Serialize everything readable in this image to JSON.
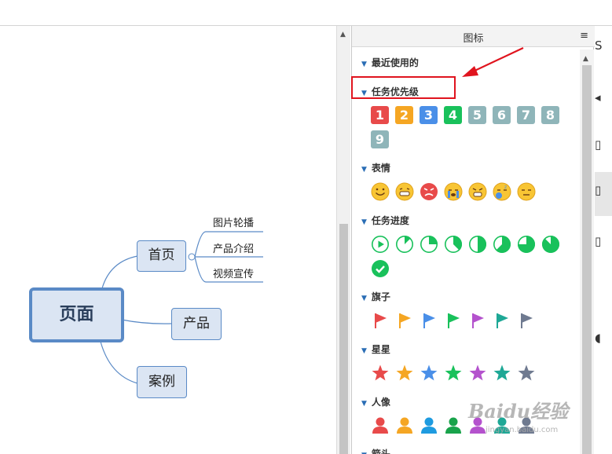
{
  "mindmap": {
    "root": "页面",
    "branches": [
      "首页",
      "产品",
      "案例"
    ],
    "leaves": [
      "图片轮播",
      "产品介绍",
      "视频宣传"
    ]
  },
  "panel": {
    "title": "图标",
    "menu_icon": "≡",
    "sections": [
      {
        "title": "最近使用的"
      },
      {
        "title": "任务优先级",
        "items": [
          "1",
          "2",
          "3",
          "4",
          "5",
          "6",
          "7",
          "8",
          "9"
        ],
        "colors": [
          "#e84a4a",
          "#f5a623",
          "#4a8fe8",
          "#19c15b",
          "#8fb5b9",
          "#8fb5b9",
          "#8fb5b9",
          "#8fb5b9",
          "#8fb5b9"
        ]
      },
      {
        "title": "表情",
        "items": [
          "smile-face-icon",
          "grin-face-icon",
          "angry-face-icon",
          "crying-face-icon",
          "scream-face-icon",
          "sleepy-face-icon",
          "neutral-face-icon"
        ]
      },
      {
        "title": "任务进度",
        "items": [
          "progress-start-icon",
          "progress-12-icon",
          "progress-25-icon",
          "progress-37-icon",
          "progress-50-icon",
          "progress-62-icon",
          "progress-75-icon",
          "progress-87-icon",
          "progress-done-icon"
        ]
      },
      {
        "title": "旗子",
        "colors": [
          "#e84a4a",
          "#f5a623",
          "#4a8fe8",
          "#19c15b",
          "#b452cd",
          "#1ea896",
          "#6f7a90"
        ]
      },
      {
        "title": "星星",
        "colors": [
          "#e84a4a",
          "#f5a623",
          "#4a8fe8",
          "#19c15b",
          "#b452cd",
          "#1ea896",
          "#6f7a90"
        ]
      },
      {
        "title": "人像",
        "colors": [
          "#e84a4a",
          "#f5a623",
          "#1e9be0",
          "#19a34b",
          "#b452cd",
          "#1ea896",
          "#6f7a90"
        ]
      },
      {
        "title": "箭头"
      }
    ]
  },
  "watermark": {
    "text": "Baidu经验",
    "sub": "jingyan.baidu.com"
  },
  "colors": {
    "accent": "#5a8ac6",
    "highlight": "#e0141e"
  }
}
